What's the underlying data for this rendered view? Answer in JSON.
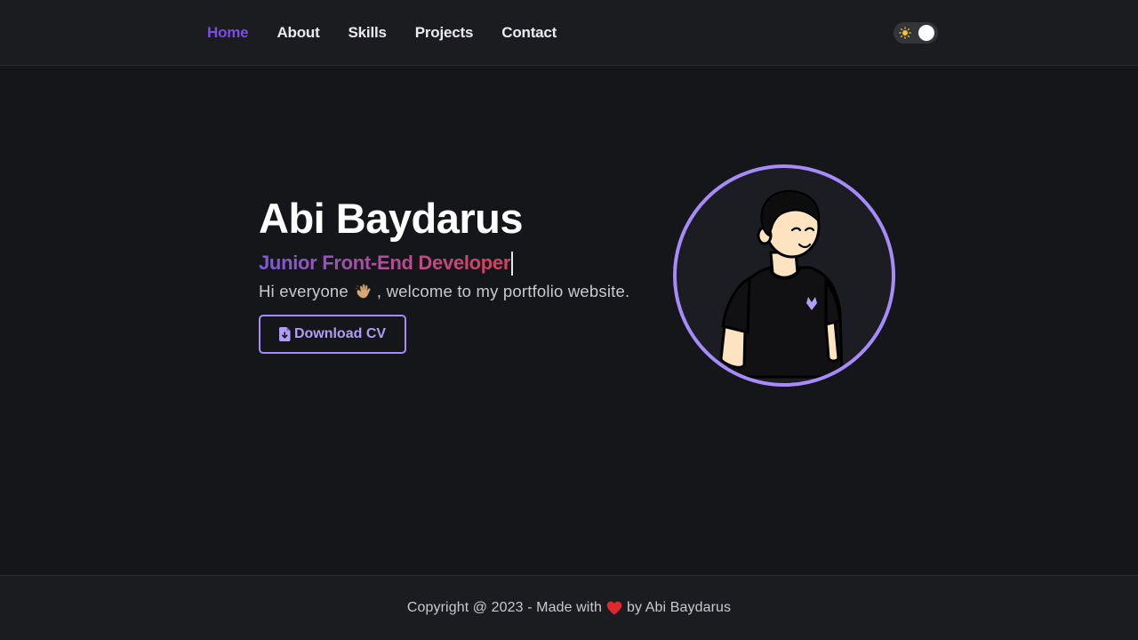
{
  "nav": {
    "links": [
      {
        "label": "Home",
        "active": true
      },
      {
        "label": "About"
      },
      {
        "label": "Skills"
      },
      {
        "label": "Projects"
      },
      {
        "label": "Contact"
      }
    ],
    "theme_toggle": {
      "icon": "sun-icon",
      "state": "dark"
    }
  },
  "hero": {
    "name": "Abi Baydarus",
    "role": "Junior Front-End Developer",
    "greeting_before": "Hi everyone",
    "greeting_emoji": "waving-hand-icon",
    "greeting_after": ", welcome to my portfolio website.",
    "download_label": "Download CV",
    "download_icon": "file-download-icon",
    "avatar_icon": "avatar-illustration"
  },
  "footer": {
    "text_before": "Copyright @ 2023 - Made with",
    "heart_icon": "heart-icon",
    "text_after": "by Abi Baydarus"
  },
  "colors": {
    "background": "#151619",
    "surface": "#1b1c20",
    "accent": "#a78bfa",
    "active_link": "#7c4ce6",
    "role_gradient_start": "#7d5bd9",
    "role_gradient_end": "#d9405d"
  }
}
